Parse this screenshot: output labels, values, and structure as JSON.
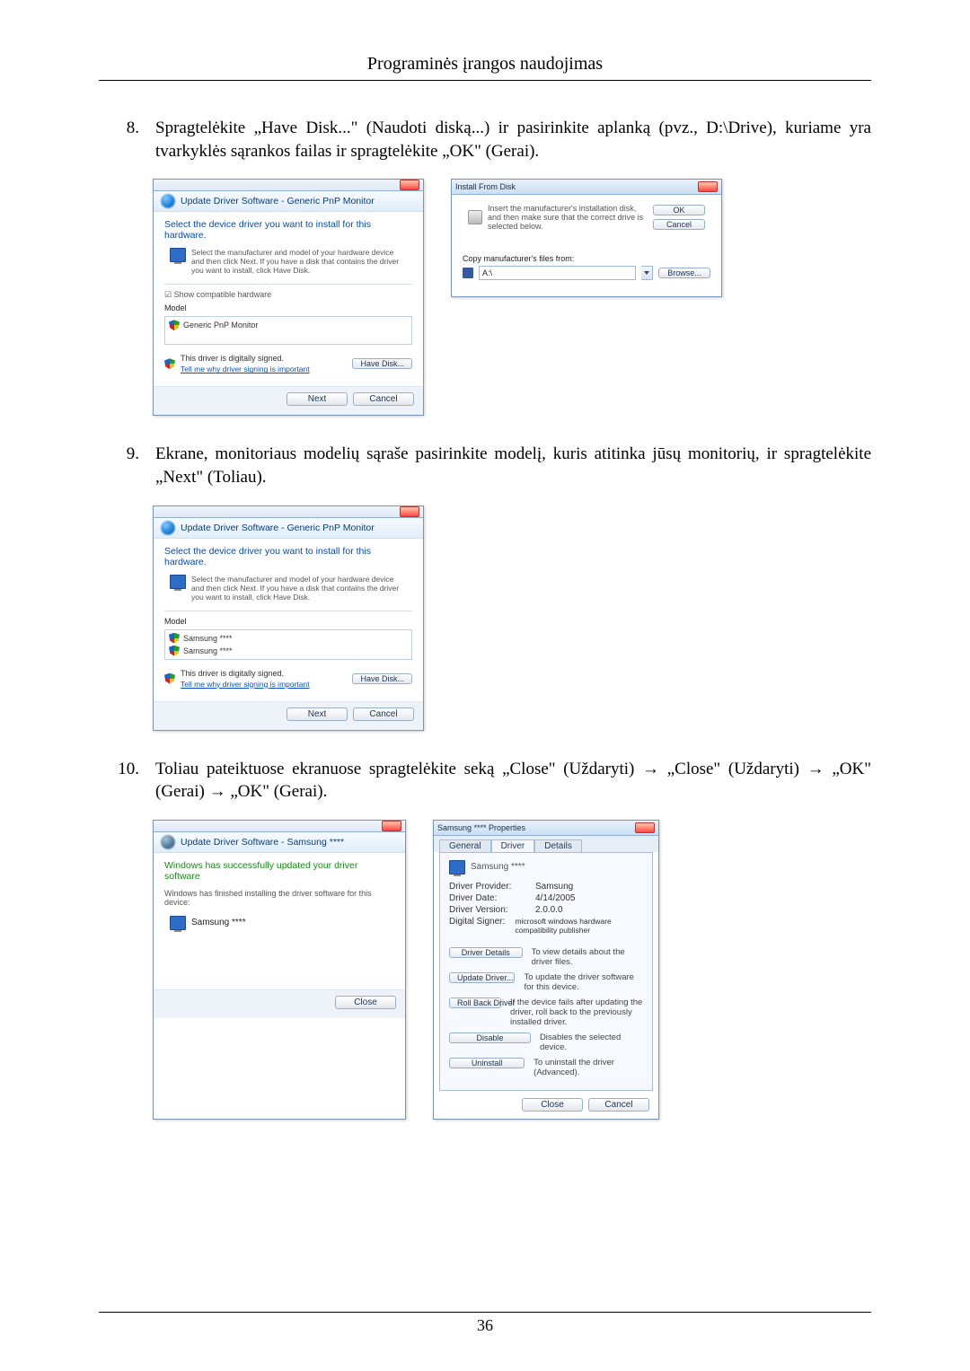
{
  "page": {
    "header": "Programinės įrangos naudojimas",
    "number": "36"
  },
  "step8": {
    "num": "8.",
    "text": "Spragtelėkite „Have Disk...\" (Naudoti diską...) ir pasirinkite aplanką (pvz., D:\\Drive), kuriame yra tvarkyklės sąrankos failas ir spragtelėkite „OK\" (Gerai)."
  },
  "step9": {
    "num": "9.",
    "text": "Ekrane, monitoriaus modelių sąraše pasirinkite modelį, kuris atitinka jūsų monitorių, ir spragtelėkite „Next\" (Toliau)."
  },
  "step10": {
    "num": "10.",
    "text": "Toliau pateiktuose ekranuose spragtelėkite seką „Close\" (Uždaryti) → „Close\" (Uždaryti) → „OK\" (Gerai) → „OK\" (Gerai)."
  },
  "dlg": {
    "update_title": "Update Driver Software - Generic PnP Monitor",
    "update_title2": "Update Driver Software - Samsung ****",
    "select_hdr": "Select the device driver you want to install for this hardware.",
    "hint": "Select the manufacturer and model of your hardware device and then click Next. If you have a disk that contains the driver you want to install, click Have Disk.",
    "compat_chk": "Show compatible hardware",
    "model_label": "Model",
    "generic_item": "Generic PnP Monitor",
    "samsung_item1": "Samsung ****",
    "samsung_item2": "Samsung ****",
    "signed": "This driver is digitally signed.",
    "signed_link": "Tell me why driver signing is important",
    "have_disk": "Have Disk...",
    "next": "Next",
    "cancel": "Cancel",
    "close": "Close"
  },
  "install": {
    "title": "Install From Disk",
    "msg": "Insert the manufacturer's installation disk, and then make sure that the correct drive is selected below.",
    "copy_label": "Copy manufacturer's files from:",
    "path": "A:\\",
    "ok": "OK",
    "browse": "Browse..."
  },
  "done": {
    "hdr": "Windows has successfully updated your driver software",
    "sub": "Windows has finished installing the driver software for this device:",
    "device": "Samsung ****"
  },
  "props": {
    "title": "Samsung **** Properties",
    "tabs": {
      "general": "General",
      "driver": "Driver",
      "details": "Details"
    },
    "device": "Samsung ****",
    "k1": "Driver Provider:",
    "v1": "Samsung",
    "k2": "Driver Date:",
    "v2": "4/14/2005",
    "k3": "Driver Version:",
    "v3": "2.0.0.0",
    "k4": "Digital Signer:",
    "v4": "microsoft windows hardware compatibility publisher",
    "btns": {
      "details": "Driver Details",
      "details_d": "To view details about the driver files.",
      "update": "Update Driver...",
      "update_d": "To update the driver software for this device.",
      "rollback": "Roll Back Driver",
      "rollback_d": "If the device fails after updating the driver, roll back to the previously installed driver.",
      "disable": "Disable",
      "disable_d": "Disables the selected device.",
      "uninstall": "Uninstall",
      "uninstall_d": "To uninstall the driver (Advanced)."
    }
  }
}
